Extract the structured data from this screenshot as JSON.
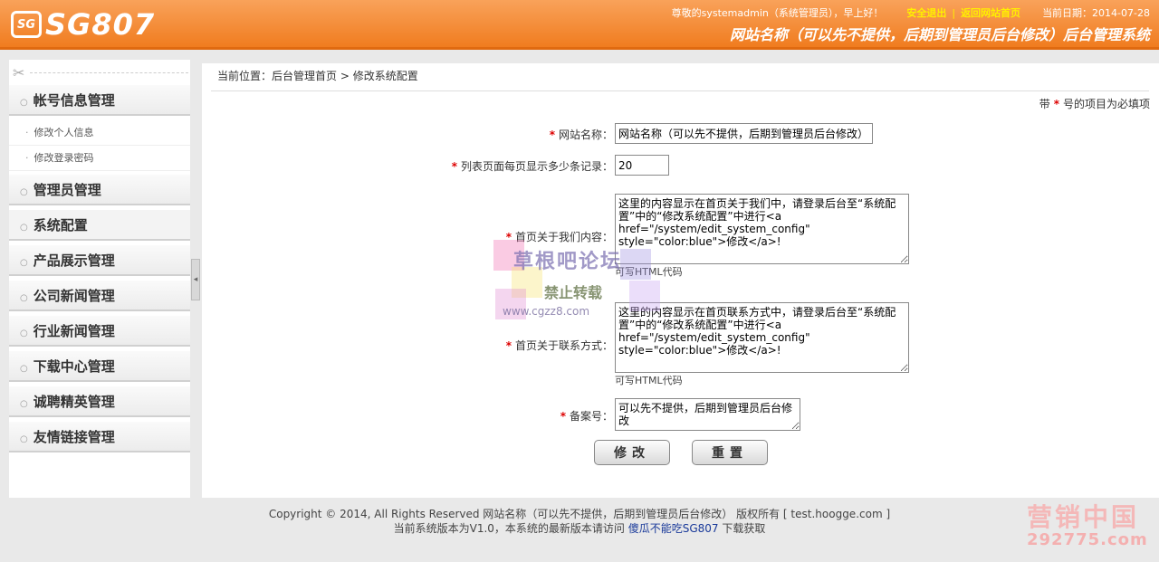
{
  "header": {
    "logo_box_text": "SG",
    "logo_text": "SG807",
    "greeting": "尊敬的systemadmin（系统管理员），早上好！",
    "logout": "安全退出",
    "separator": "|",
    "home_link": "返回网站首页",
    "date": "当前日期：2014-07-28",
    "site_banner": "网站名称（可以先不提供，后期到管理员后台修改）后台管理系统"
  },
  "sidebar": {
    "scissor_icon": "✂",
    "groups": [
      {
        "label": "帐号信息管理",
        "items": [
          "修改个人信息",
          "修改登录密码"
        ]
      },
      {
        "label": "管理员管理"
      },
      {
        "label": "系统配置"
      },
      {
        "label": "产品展示管理"
      },
      {
        "label": "公司新闻管理"
      },
      {
        "label": "行业新闻管理"
      },
      {
        "label": "下载中心管理"
      },
      {
        "label": "诚聘精英管理"
      },
      {
        "label": "友情链接管理"
      }
    ],
    "collapse_icon": "◂"
  },
  "breadcrumb": {
    "prefix": "当前位置：",
    "home": "后台管理首页",
    "sep": ">",
    "current": "修改系统配置"
  },
  "required_note": {
    "before": "带",
    "star": "*",
    "after": "号的项目为必填项"
  },
  "form": {
    "site_name": {
      "label": "网站名称：",
      "value": "网站名称（可以先不提供，后期到管理员后台修改）"
    },
    "page_size": {
      "label": "列表页面每页显示多少条记录：",
      "value": "20"
    },
    "about": {
      "label": "首页关于我们内容：",
      "value": "这里的内容显示在首页关于我们中，请登录后台至“系统配置”中的“修改系统配置”中进行<a href=\"/system/edit_system_config\" style=\"color:blue\">修改</a>!",
      "hint": "可写HTML代码"
    },
    "contact": {
      "label": "首页关于联系方式：",
      "value": "这里的内容显示在首页联系方式中，请登录后台至“系统配置”中的“修改系统配置”中进行<a href=\"/system/edit_system_config\" style=\"color:blue\">修改</a>!",
      "hint": "可写HTML代码"
    },
    "icp": {
      "label": "备案号：",
      "value": "可以先不提供，后期到管理员后台修改"
    },
    "star": "*",
    "submit_label": "修改",
    "reset_label": "重置"
  },
  "footer": {
    "line1": "Copyright © 2014, All Rights Reserved 网站名称（可以先不提供，后期到管理员后台修改） 版权所有 [ test.hoogge.com ]",
    "line2_prefix": "当前系统版本为V1.0，本系统的最新版本请访问 ",
    "line2_link": "傻瓜不能吃SG807",
    "line2_suffix": " 下载获取"
  },
  "watermark": {
    "title": "草根吧论坛",
    "sub": "禁止转载",
    "url": "www.cgzz8.com",
    "corner_1": "营销中国",
    "corner_2": "292775.com"
  }
}
